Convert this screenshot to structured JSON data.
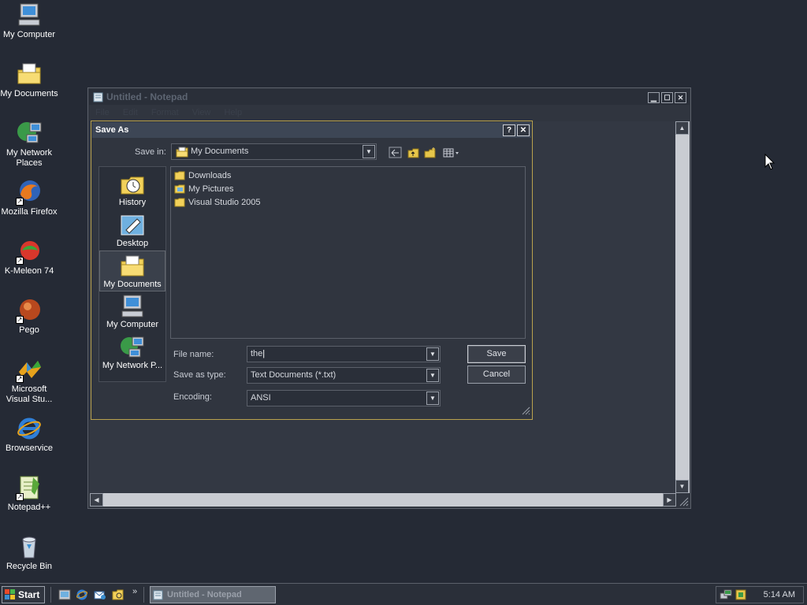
{
  "desktop": {
    "icons": [
      {
        "label": "My Computer",
        "icon": "computer-icon"
      },
      {
        "label": "My Documents",
        "icon": "documents-folder-icon"
      },
      {
        "label": "My Network Places",
        "icon": "network-icon"
      },
      {
        "label": "Mozilla Firefox",
        "icon": "firefox-icon"
      },
      {
        "label": "K-Meleon 74",
        "icon": "k-meleon-icon"
      },
      {
        "label": "Pego",
        "icon": "pego-icon"
      },
      {
        "label": "Microsoft Visual Stu...",
        "icon": "visual-studio-icon"
      },
      {
        "label": "Browservice",
        "icon": "internet-explorer-icon"
      },
      {
        "label": "Notepad++",
        "icon": "notepad-plus-icon"
      },
      {
        "label": "Recycle Bin",
        "icon": "recycle-bin-icon"
      }
    ]
  },
  "notepad": {
    "title": "Untitled - Notepad",
    "menu": [
      "File",
      "Edit",
      "Format",
      "View",
      "Help"
    ]
  },
  "dialog": {
    "title": "Save As",
    "help_label": "?",
    "close_label": "✕",
    "save_in_label": "Save in:",
    "save_in_value": "My Documents",
    "places": [
      "History",
      "Desktop",
      "My Documents",
      "My Computer",
      "My Network P..."
    ],
    "files": [
      "Downloads",
      "My Pictures",
      "Visual Studio 2005"
    ],
    "file_name_label": "File name:",
    "file_name_value": "the",
    "save_as_type_label": "Save as type:",
    "save_as_type_value": "Text Documents (*.txt)",
    "encoding_label": "Encoding:",
    "encoding_value": "ANSI",
    "save_button": "Save",
    "cancel_button": "Cancel"
  },
  "taskbar": {
    "start_label": "Start",
    "task_label": "Untitled - Notepad",
    "clock": "5:14 AM"
  },
  "colors": {
    "desktop_bg": "#252a35",
    "dialog_border": "#b9a24e",
    "folder_yellow": "#f2d15a"
  }
}
